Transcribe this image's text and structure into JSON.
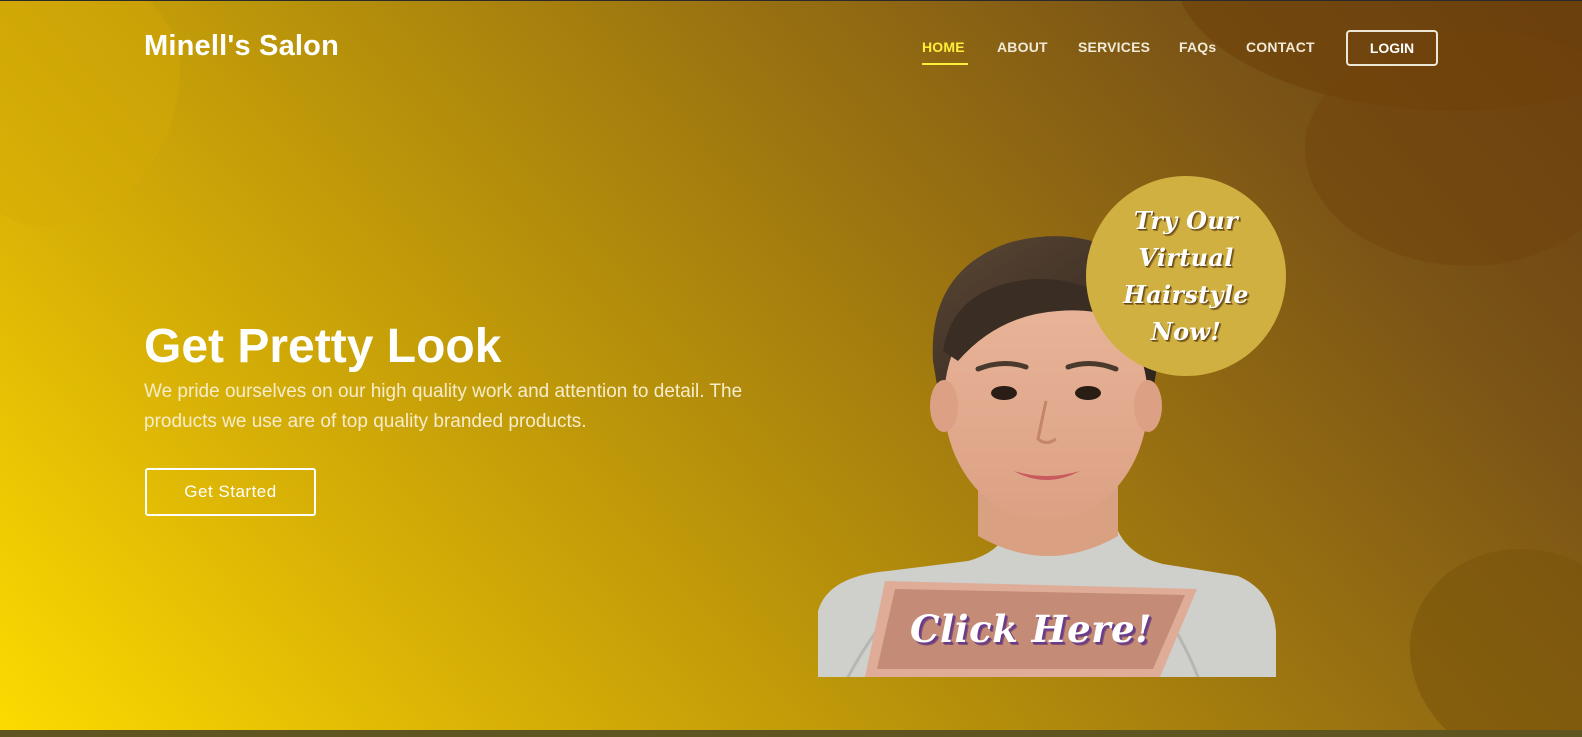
{
  "brand": {
    "name": "Minell's Salon"
  },
  "nav": {
    "items": [
      {
        "label": "HOME",
        "active": true
      },
      {
        "label": "ABOUT",
        "active": false
      },
      {
        "label": "SERVICES",
        "active": false
      },
      {
        "label": "FAQs",
        "active": false
      },
      {
        "label": "CONTACT",
        "active": false
      }
    ],
    "login_label": "LOGIN"
  },
  "hero": {
    "title": "Get Pretty Look",
    "description": "We pride ourselves on our high quality work and attention to detail. The products we use are of top quality branded products.",
    "cta_label": "Get Started"
  },
  "promo": {
    "circle_text": "Try Our Virtual Hairstyle Now!",
    "banner_text": "Click Here!"
  },
  "colors": {
    "gradient_start": "#fbdb00",
    "gradient_end": "#6a3f12",
    "nav_active": "#ffee3a",
    "promo_circle": "#cfb040",
    "banner": "#c48c76"
  }
}
